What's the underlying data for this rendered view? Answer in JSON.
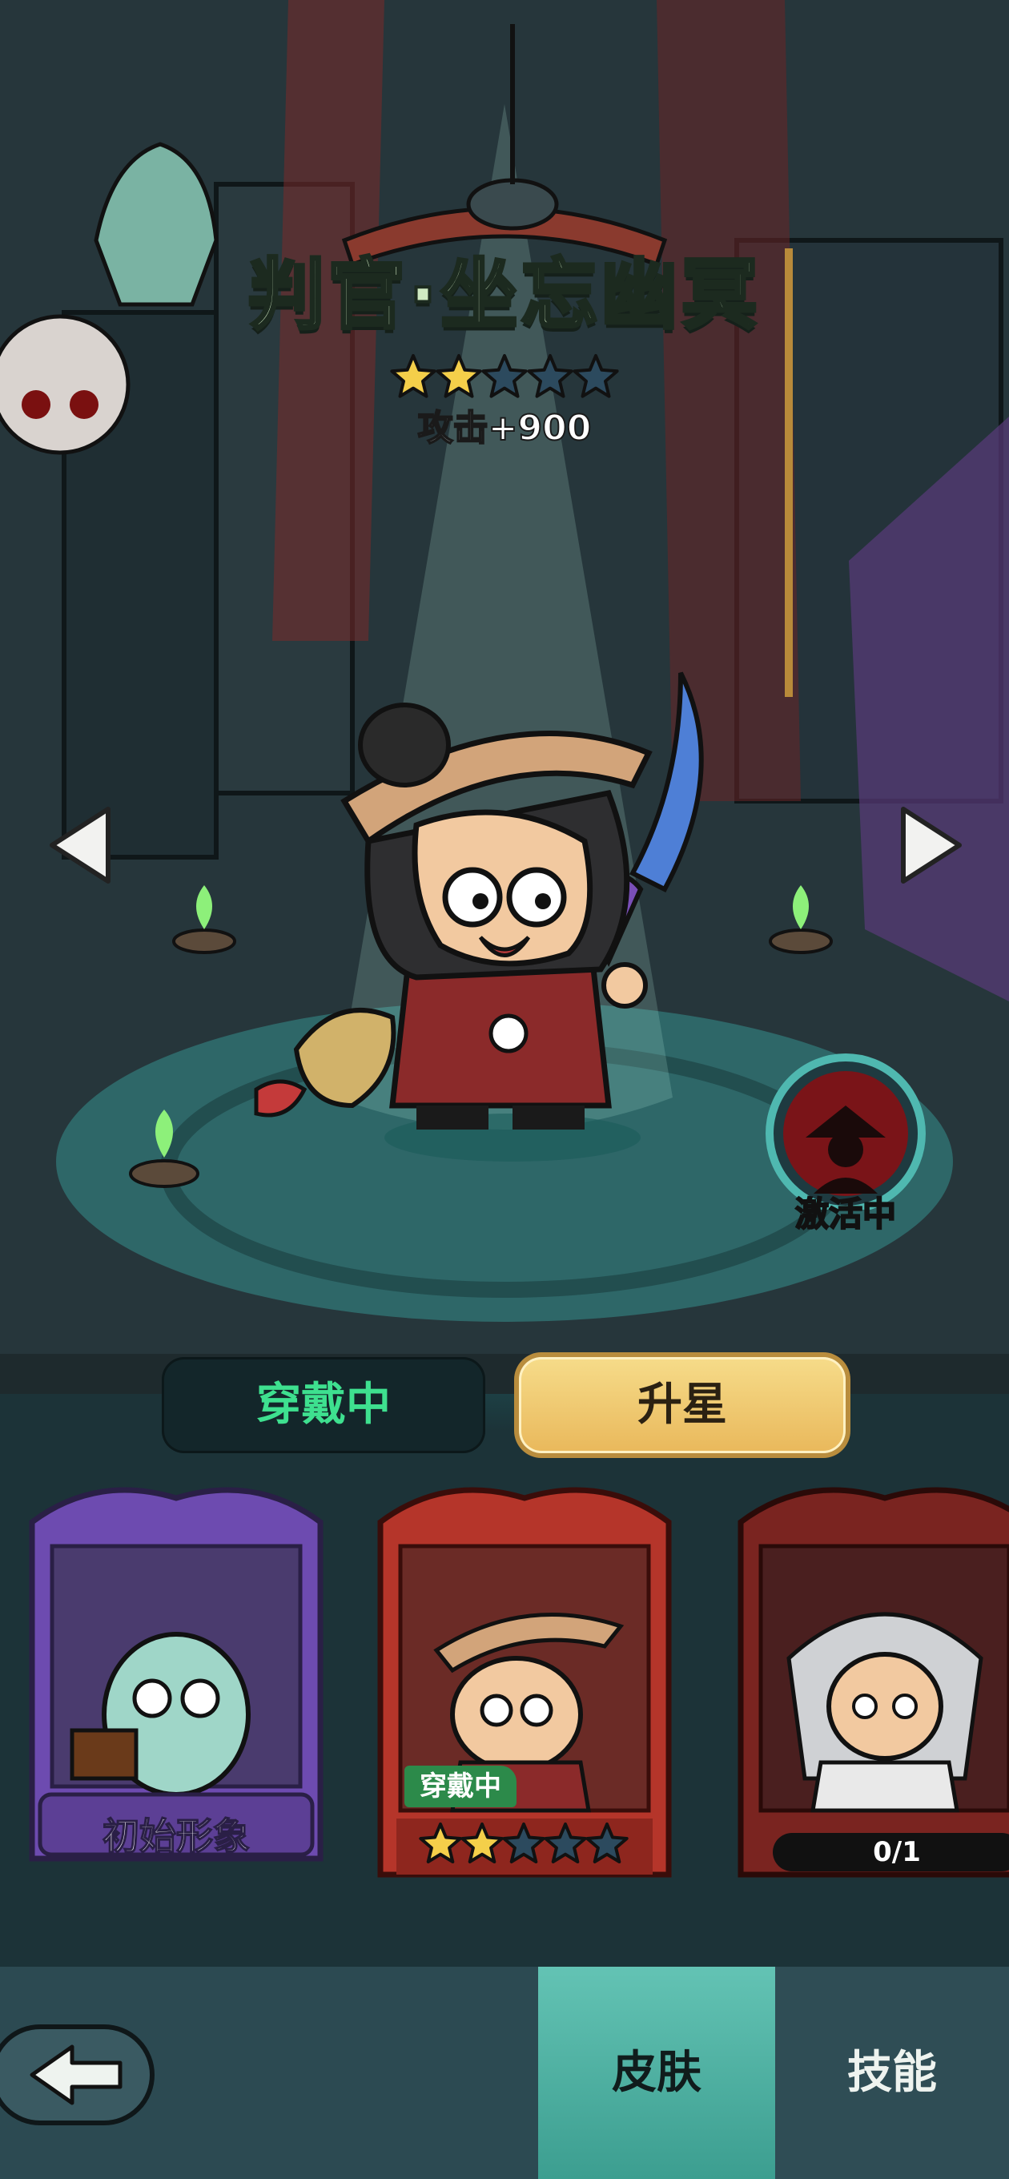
{
  "header": {
    "title": "判官·坐忘幽冥",
    "stars_filled": 2,
    "stars_total": 5,
    "bonus": "攻击+900"
  },
  "status": {
    "active": "激活中"
  },
  "actions": {
    "wear": "穿戴中",
    "upgrade": "升星"
  },
  "skins": [
    {
      "label": "初始形象"
    },
    {
      "tag": "穿戴中",
      "stars_filled": 2,
      "stars_total": 5
    },
    {
      "progress": "0/1"
    }
  ],
  "tabs": {
    "skin": "皮肤",
    "skill": "技能"
  },
  "colors": {
    "accent_green": "#3ee08f",
    "gold": "#e9b85b",
    "purple_frame": "#6d4bb0",
    "red_frame": "#b5352a"
  },
  "icons": [
    "arrow-left-icon",
    "arrow-right-icon",
    "back-icon",
    "star-icon",
    "silhouette-icon"
  ]
}
